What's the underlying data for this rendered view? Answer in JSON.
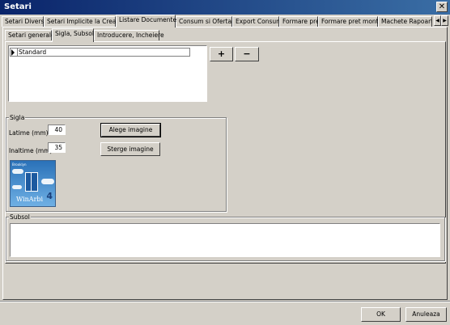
{
  "window": {
    "title": "Setari"
  },
  "main_tabs": [
    {
      "label": "Setari Diverse"
    },
    {
      "label": "Setari Implicite la Creare"
    },
    {
      "label": "Listare Documente"
    },
    {
      "label": "Consum si Ofertare"
    },
    {
      "label": "Export Consum"
    },
    {
      "label": "Formare pret"
    },
    {
      "label": "Formare pret montaj"
    },
    {
      "label": "Machete Rapoarte"
    }
  ],
  "sub_tabs": [
    {
      "label": "Setari generale"
    },
    {
      "label": "Sigla, Subsol"
    },
    {
      "label": "Introducere, Incheiere"
    }
  ],
  "list": {
    "items": [
      "Standard"
    ],
    "add_label": "+",
    "remove_label": "−"
  },
  "sigla": {
    "title": "Sigla",
    "width_label": "Latime (mm)",
    "width_value": "40",
    "height_label": "Inaltime (mm)",
    "height_value": "35",
    "choose_image": "Alege imagine",
    "delete_image": "Sterge imagine",
    "logo": {
      "brand": "Brooklyn",
      "name": "WinArbi",
      "version": "4"
    }
  },
  "subsol": {
    "title": "Subsol",
    "value": ""
  },
  "footer": {
    "ok": "OK",
    "cancel": "Anuleaza"
  }
}
